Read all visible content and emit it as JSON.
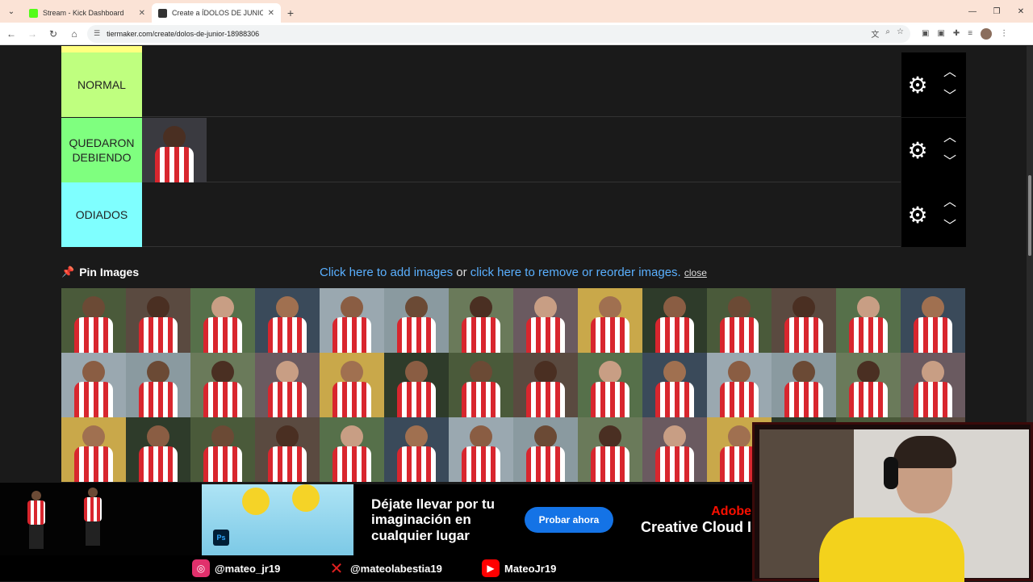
{
  "browser": {
    "tabs": [
      {
        "title": "Stream - Kick Dashboard",
        "favicon_color": "#53fc18",
        "active": false
      },
      {
        "title": "Create a ÍDOLOS DE JUNIOR Tier",
        "favicon_color": "#333333",
        "active": true
      }
    ],
    "url": "tiermaker.com/create/dolos-de-junior-18988306"
  },
  "tiers": [
    {
      "label": "NORMAL",
      "color": "#bfff7f",
      "items": 0
    },
    {
      "label": "QUEDARON DEBIENDO",
      "color": "#7fff7f",
      "items": 1
    },
    {
      "label": "ODIADOS",
      "color": "#7fffff",
      "items": 0
    }
  ],
  "pin": {
    "label": "Pin Images",
    "add_link": "Click here to add images",
    "or_text": " or ",
    "remove_link": "click here to remove or reorder images.",
    "close": "close"
  },
  "gallery": {
    "count": 42
  },
  "ad": {
    "headline": "Déjate llevar por tu imaginación en cualquier lugar",
    "button": "Probar ahora",
    "brand_line1": "Adobe",
    "brand_line2": "Creative Cloud I"
  },
  "social": [
    {
      "platform": "instagram-icon",
      "handle": "@mateo_jr19",
      "color": "#e1306c"
    },
    {
      "platform": "x-icon",
      "handle": "@mateolabestia19",
      "color": "#e02020"
    },
    {
      "platform": "youtube-icon",
      "handle": "MateoJr19",
      "color": "#ff0000"
    }
  ]
}
